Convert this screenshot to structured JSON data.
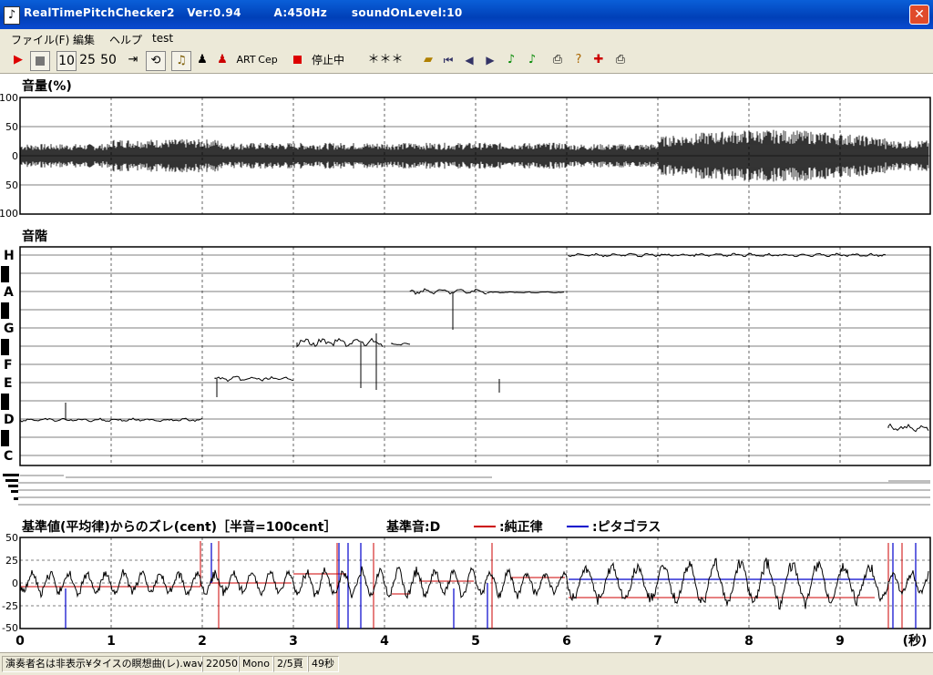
{
  "window": {
    "title": "RealTimePitchChecker2   Ver:0.94        A:450Hz      soundOnLevel:10",
    "close_glyph": "✕"
  },
  "menu": [
    "ファイル(F)",
    "編集",
    "ヘルプ",
    "test"
  ],
  "toolbar": {
    "speeds": [
      "10",
      "25",
      "50"
    ],
    "art_label": "ART",
    "cep_label": "Cep",
    "state_label": "停止中",
    "note_display": "＊＊＊"
  },
  "volume_chart": {
    "title": "音量(%)",
    "y_ticks": [
      "100",
      "50",
      "0",
      "50",
      "100"
    ]
  },
  "pitch_chart": {
    "title": "音階",
    "notes": [
      "H",
      "A",
      "G",
      "F",
      "E",
      "D",
      "C"
    ]
  },
  "deviation_chart": {
    "title": "基準値(平均律)からのズレ(cent)［半音=100cent］",
    "base_label": "基準音:D",
    "legend": [
      {
        "label": ":純正律",
        "color": "#cc0000"
      },
      {
        "label": ":ピタゴラス",
        "color": "#0000cc"
      }
    ],
    "y_ticks": [
      "50",
      "25",
      "0",
      "-25",
      "-50"
    ]
  },
  "x_axis": {
    "ticks": [
      "0",
      "1",
      "2",
      "3",
      "4",
      "5",
      "6",
      "7",
      "8",
      "9"
    ],
    "unit": "(秒)"
  },
  "status_bar": [
    "演奏者名は非表示¥タイスの瞑想曲(レ).wav",
    "22050",
    "Mono",
    "2/5頁",
    "49秒"
  ],
  "colors": {
    "title_bar": "#0a4ad0",
    "just_intonation": "#cc0000",
    "pythagorean": "#0000cc"
  }
}
